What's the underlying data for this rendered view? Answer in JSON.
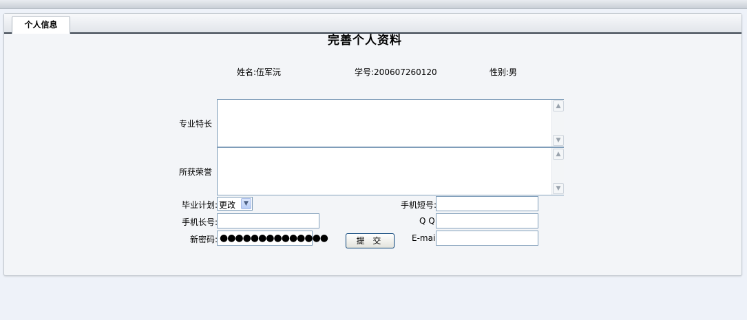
{
  "tab": {
    "label": "个人信息"
  },
  "page_title": "完善个人资料",
  "student": {
    "name": "姓名:伍军沅",
    "student_id": "学号:200607260120",
    "gender": "性别:男"
  },
  "form": {
    "specialty_label": "专业特长",
    "specialty_value": "",
    "honors_label": "所获荣誉",
    "honors_value": "",
    "grad_plan_label": "毕业计划:",
    "grad_plan_selected": "更改",
    "short_phone_label": "手机短号:",
    "short_phone_value": "",
    "long_phone_label": "手机长号:",
    "long_phone_value": "",
    "qq_label": "Q Q:",
    "qq_value": "",
    "password_label": "新密码:",
    "password_mask": "●●●●●●●●●●●●●●",
    "email_label": "E-mail:",
    "email_value": "",
    "submit_label": "提 交"
  },
  "icons": {
    "scroll_up": "scroll-up-arrow-icon",
    "scroll_down": "scroll-down-arrow-icon",
    "dropdown": "chevron-down-icon"
  }
}
